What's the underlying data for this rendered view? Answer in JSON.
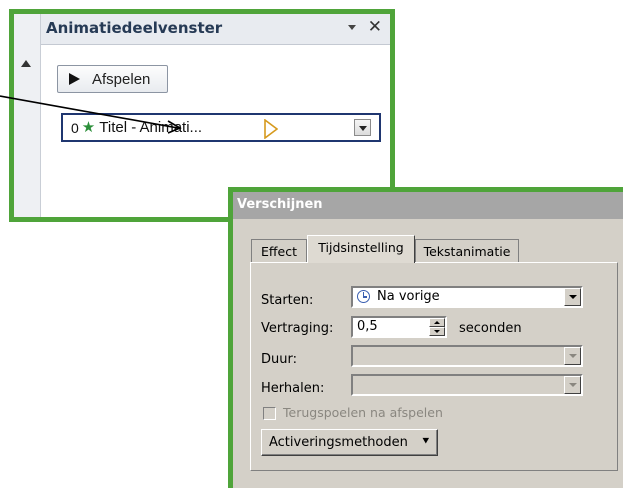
{
  "animation_pane": {
    "title": "Animatiedeelvenster",
    "close_glyph": "✕",
    "play_label": "Afspelen",
    "item": {
      "index": "0",
      "label": "Titel - Animati..."
    }
  },
  "effect_dialog": {
    "title": "Verschijnen",
    "tabs": [
      {
        "label": "Effect",
        "active": false
      },
      {
        "label": "Tijdsinstelling",
        "active": true
      },
      {
        "label": "Tekstanimatie",
        "active": false
      }
    ],
    "start_label": "Starten:",
    "start_value": "Na vorige",
    "delay_label": "Vertraging:",
    "delay_value": "0,5",
    "delay_unit": "seconden",
    "duration_label": "Duur:",
    "repeat_label": "Herhalen:",
    "rewind_label": "Terugspoelen na afspelen",
    "rewind_checked": false,
    "triggers_label": "Activeringsmethoden",
    "triggers_arrow": "⯆"
  },
  "colors": {
    "callout_border": "#4fa43a",
    "selected_item_border": "#1f3670",
    "dialog_titlebar": "#a6a6a6"
  },
  "icons": [
    "play-icon",
    "star-icon",
    "trigger-icon",
    "chevron-down-icon",
    "close-icon",
    "clock-icon",
    "spin-up-icon",
    "spin-down-icon"
  ]
}
